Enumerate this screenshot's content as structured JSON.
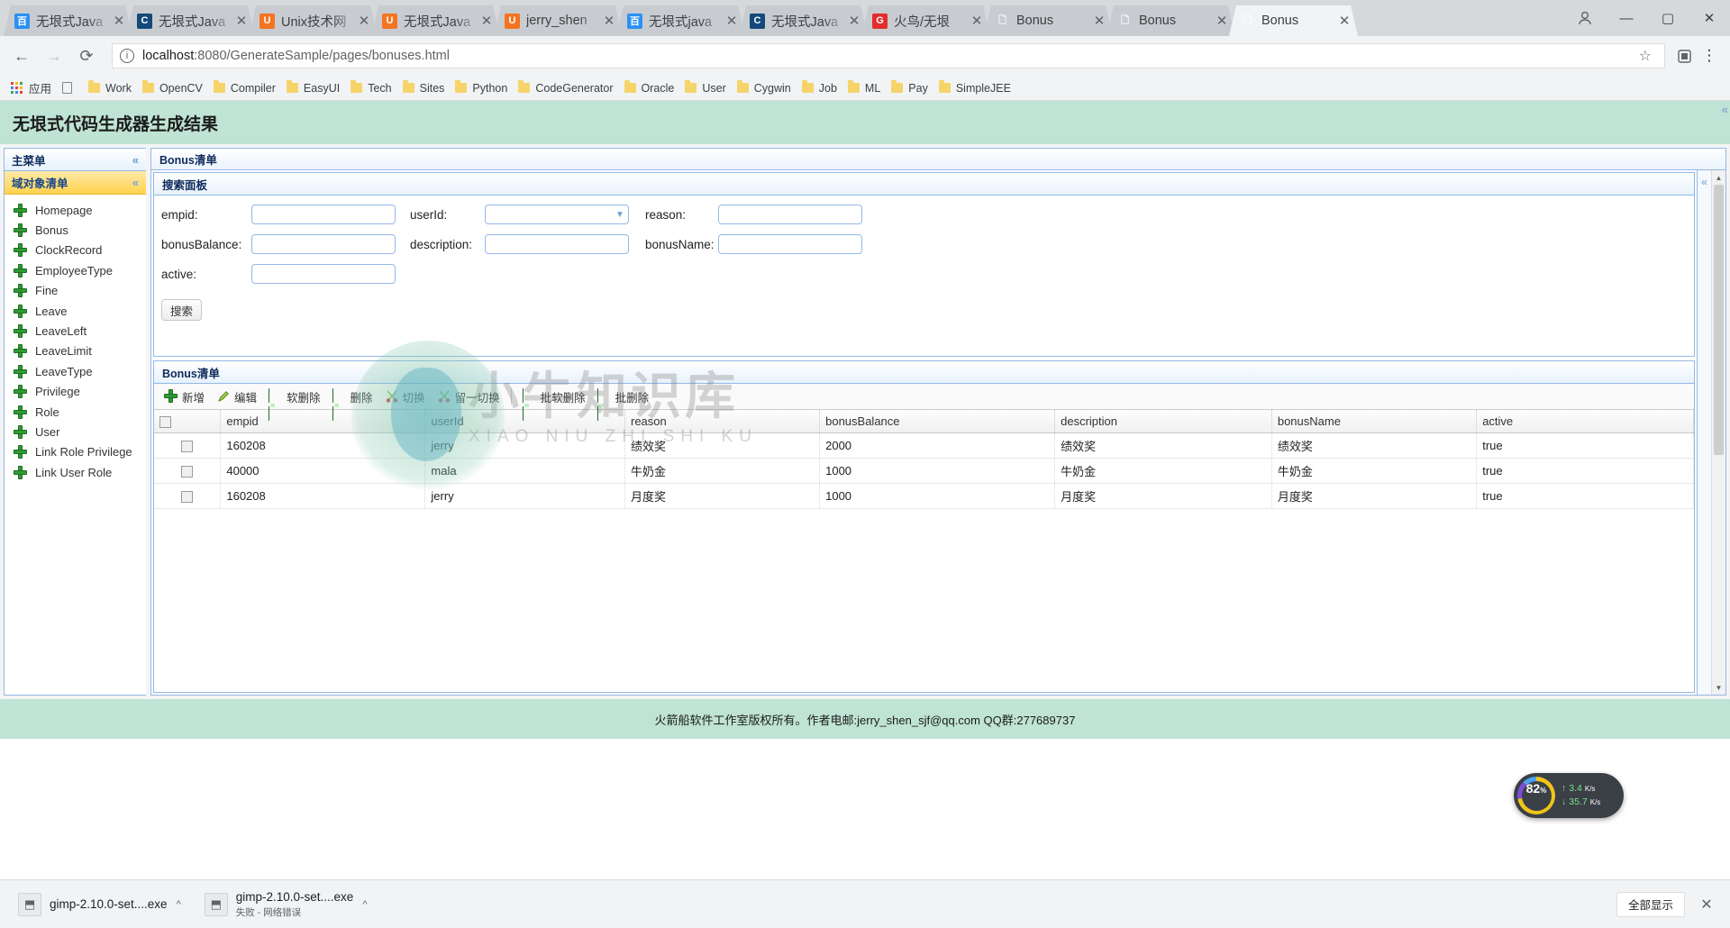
{
  "browser": {
    "tabs": [
      {
        "title": "无垠式Java",
        "favicon": "baidu-icon",
        "active": false
      },
      {
        "title": "无垠式Java",
        "favicon": "csdn-icon",
        "active": false
      },
      {
        "title": "Unix技术网",
        "favicon": "ubuntu-icon",
        "active": false
      },
      {
        "title": "无垠式Java",
        "favicon": "ubuntu-icon",
        "active": false
      },
      {
        "title": "jerry_shen",
        "favicon": "ubuntu-icon",
        "active": false
      },
      {
        "title": "无垠式java",
        "favicon": "baidu-icon",
        "active": false
      },
      {
        "title": "无垠式Java",
        "favicon": "csdn-icon",
        "active": false
      },
      {
        "title": "火鸟/无垠",
        "favicon": "gitee-icon",
        "active": false
      },
      {
        "title": "Bonus",
        "favicon": "document-icon",
        "active": false
      },
      {
        "title": "Bonus",
        "favicon": "document-icon",
        "active": false
      },
      {
        "title": "Bonus",
        "favicon": "document-icon",
        "active": true
      }
    ],
    "tab_close_glyph": "✕",
    "nav": {
      "back": "←",
      "forward": "→",
      "reload": "⟳",
      "info_glyph": "ⓘ",
      "url_host": "localhost",
      "url_rest": ":8080/GenerateSample/pages/bonuses.html",
      "star": "☆",
      "extension": "▣",
      "menu": "⋮"
    },
    "window_controls": {
      "minimize": "—",
      "maximize": "▢",
      "close": "✕",
      "profile": "👤"
    },
    "bookmarks": {
      "apps_label": "应用",
      "items": [
        {
          "label": "Work",
          "icon": "folder-icon"
        },
        {
          "label": "OpenCV",
          "icon": "folder-icon"
        },
        {
          "label": "Compiler",
          "icon": "folder-icon"
        },
        {
          "label": "EasyUI",
          "icon": "folder-icon"
        },
        {
          "label": "Tech",
          "icon": "folder-icon"
        },
        {
          "label": "Sites",
          "icon": "folder-icon"
        },
        {
          "label": "Python",
          "icon": "folder-icon"
        },
        {
          "label": "CodeGenerator",
          "icon": "folder-icon"
        },
        {
          "label": "Oracle",
          "icon": "folder-icon"
        },
        {
          "label": "User",
          "icon": "folder-icon"
        },
        {
          "label": "Cygwin",
          "icon": "folder-icon"
        },
        {
          "label": "Job",
          "icon": "folder-icon"
        },
        {
          "label": "ML",
          "icon": "folder-icon"
        },
        {
          "label": "Pay",
          "icon": "folder-icon"
        },
        {
          "label": "SimpleJEE",
          "icon": "folder-icon"
        }
      ]
    }
  },
  "page": {
    "header_title": "无垠式代码生成器生成结果",
    "footer": "火箭船软件工作室版权所有。作者电邮:jerry_shen_sjf@qq.com QQ群:277689737",
    "collapse_left_glyph": "«",
    "collapse_right_glyph": "«",
    "expand_glyph": "«"
  },
  "sidebar": {
    "title": "主菜单",
    "accordion_title": "域对象清单",
    "collapse_glyph": "«",
    "caret_glyph": "«",
    "items": [
      {
        "label": "Homepage",
        "icon": "plus-node-icon"
      },
      {
        "label": "Bonus",
        "icon": "plus-node-icon"
      },
      {
        "label": "ClockRecord",
        "icon": "plus-node-icon"
      },
      {
        "label": "EmployeeType",
        "icon": "plus-node-icon"
      },
      {
        "label": "Fine",
        "icon": "plus-node-icon"
      },
      {
        "label": "Leave",
        "icon": "plus-node-icon"
      },
      {
        "label": "LeaveLeft",
        "icon": "plus-node-icon"
      },
      {
        "label": "LeaveLimit",
        "icon": "plus-node-icon"
      },
      {
        "label": "LeaveType",
        "icon": "plus-node-icon"
      },
      {
        "label": "Privilege",
        "icon": "plus-node-icon"
      },
      {
        "label": "Role",
        "icon": "plus-node-icon"
      },
      {
        "label": "User",
        "icon": "plus-node-icon"
      },
      {
        "label": "Link Role Privilege",
        "icon": "plus-node-icon"
      },
      {
        "label": "Link User Role",
        "icon": "plus-node-icon"
      }
    ]
  },
  "main": {
    "panel_title": "Bonus清单",
    "search": {
      "title": "搜索面板",
      "fields": [
        {
          "label": "empid:",
          "type": "text",
          "value": ""
        },
        {
          "label": "userId:",
          "type": "combo",
          "value": ""
        },
        {
          "label": "reason:",
          "type": "text",
          "value": ""
        },
        {
          "label": "bonusBalance:",
          "type": "text",
          "value": ""
        },
        {
          "label": "description:",
          "type": "text",
          "value": ""
        },
        {
          "label": "bonusName:",
          "type": "text",
          "value": ""
        },
        {
          "label": "active:",
          "type": "text",
          "value": ""
        }
      ],
      "submit_label": "搜索"
    },
    "grid": {
      "title": "Bonus清单",
      "toolbar": [
        {
          "label": "新增",
          "icon": "add-icon"
        },
        {
          "label": "编辑",
          "icon": "edit-pencil-icon"
        },
        {
          "label": "软删除",
          "icon": "soft-delete-icon"
        },
        {
          "label": "删除",
          "icon": "delete-icon"
        },
        {
          "label": "切换",
          "icon": "toggle-scissors-icon"
        },
        {
          "label": "留一切换",
          "icon": "keep-one-scissors-icon"
        },
        {
          "label": "批软删除",
          "icon": "batch-soft-delete-icon"
        },
        {
          "label": "批删除",
          "icon": "batch-delete-icon"
        }
      ],
      "columns": [
        "empid",
        "userId",
        "reason",
        "bonusBalance",
        "description",
        "bonusName",
        "active"
      ],
      "rows": [
        {
          "checked": false,
          "empid": "160208",
          "userId": "jerry",
          "reason": "绩效奖",
          "bonusBalance": "2000",
          "description": "绩效奖",
          "bonusName": "绩效奖",
          "active": "true"
        },
        {
          "checked": false,
          "empid": "40000",
          "userId": "mala",
          "reason": "牛奶金",
          "bonusBalance": "1000",
          "description": "牛奶金",
          "bonusName": "牛奶金",
          "active": "true"
        },
        {
          "checked": false,
          "empid": "160208",
          "userId": "jerry",
          "reason": "月度奖",
          "bonusBalance": "1000",
          "description": "月度奖",
          "bonusName": "月度奖",
          "active": "true"
        }
      ]
    }
  },
  "watermark": {
    "title": "小牛知识库",
    "subtitle": "XIAO NIU ZHI SHI KU"
  },
  "netmonitor": {
    "percent": "82",
    "percent_unit": "%",
    "up_rate": "3.4",
    "up_unit": "K/s",
    "down_rate": "35.7",
    "down_unit": "K/s",
    "up_glyph": "↑",
    "down_glyph": "↓"
  },
  "downloads": {
    "items": [
      {
        "name": "gimp-2.10.0-set....exe",
        "sub": "",
        "caret": "^"
      },
      {
        "name": "gimp-2.10.0-set....exe",
        "sub": "失败 - 网络错误",
        "caret": "^"
      }
    ],
    "show_all_label": "全部显示",
    "close_glyph": "✕"
  },
  "colors": {
    "page_accent": "#bfe3d4",
    "panel_border": "#95b8e7",
    "accordion": "#ffd24d",
    "title_text": "#0e2b5c"
  }
}
